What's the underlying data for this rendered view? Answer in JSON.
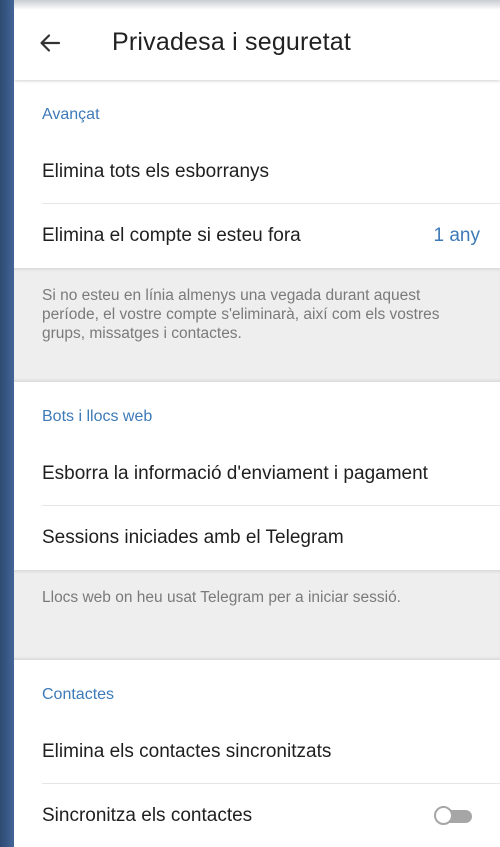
{
  "header": {
    "back_icon": "arrow-left-icon",
    "title": "Privadesa i seguretat"
  },
  "sections": {
    "advanced": {
      "title": "Avançat",
      "delete_drafts": "Elimina tots els esborranys",
      "delete_account": "Elimina el compte si esteu fora",
      "delete_account_value": "1 any",
      "info": "Si no esteu en línia almenys una vegada durant aquest període, el vostre compte s'eliminarà, així com els vostres grups, missatges i contactes."
    },
    "bots": {
      "title": "Bots i llocs web",
      "clear_payment": "Esborra la informació d'enviament i pagament",
      "telegram_sessions": "Sessions iniciades amb el Telegram",
      "info": "Llocs web on heu usat Telegram per a iniciar sessió."
    },
    "contacts": {
      "title": "Contactes",
      "delete_synced": "Elimina els contactes sincronitzats",
      "sync_contacts": "Sincronitza els contactes",
      "sync_enabled": false
    }
  },
  "colors": {
    "accent": "#3d7ab8",
    "toggle_off": "#a6a6a6",
    "info_background": "#eeeeee"
  }
}
